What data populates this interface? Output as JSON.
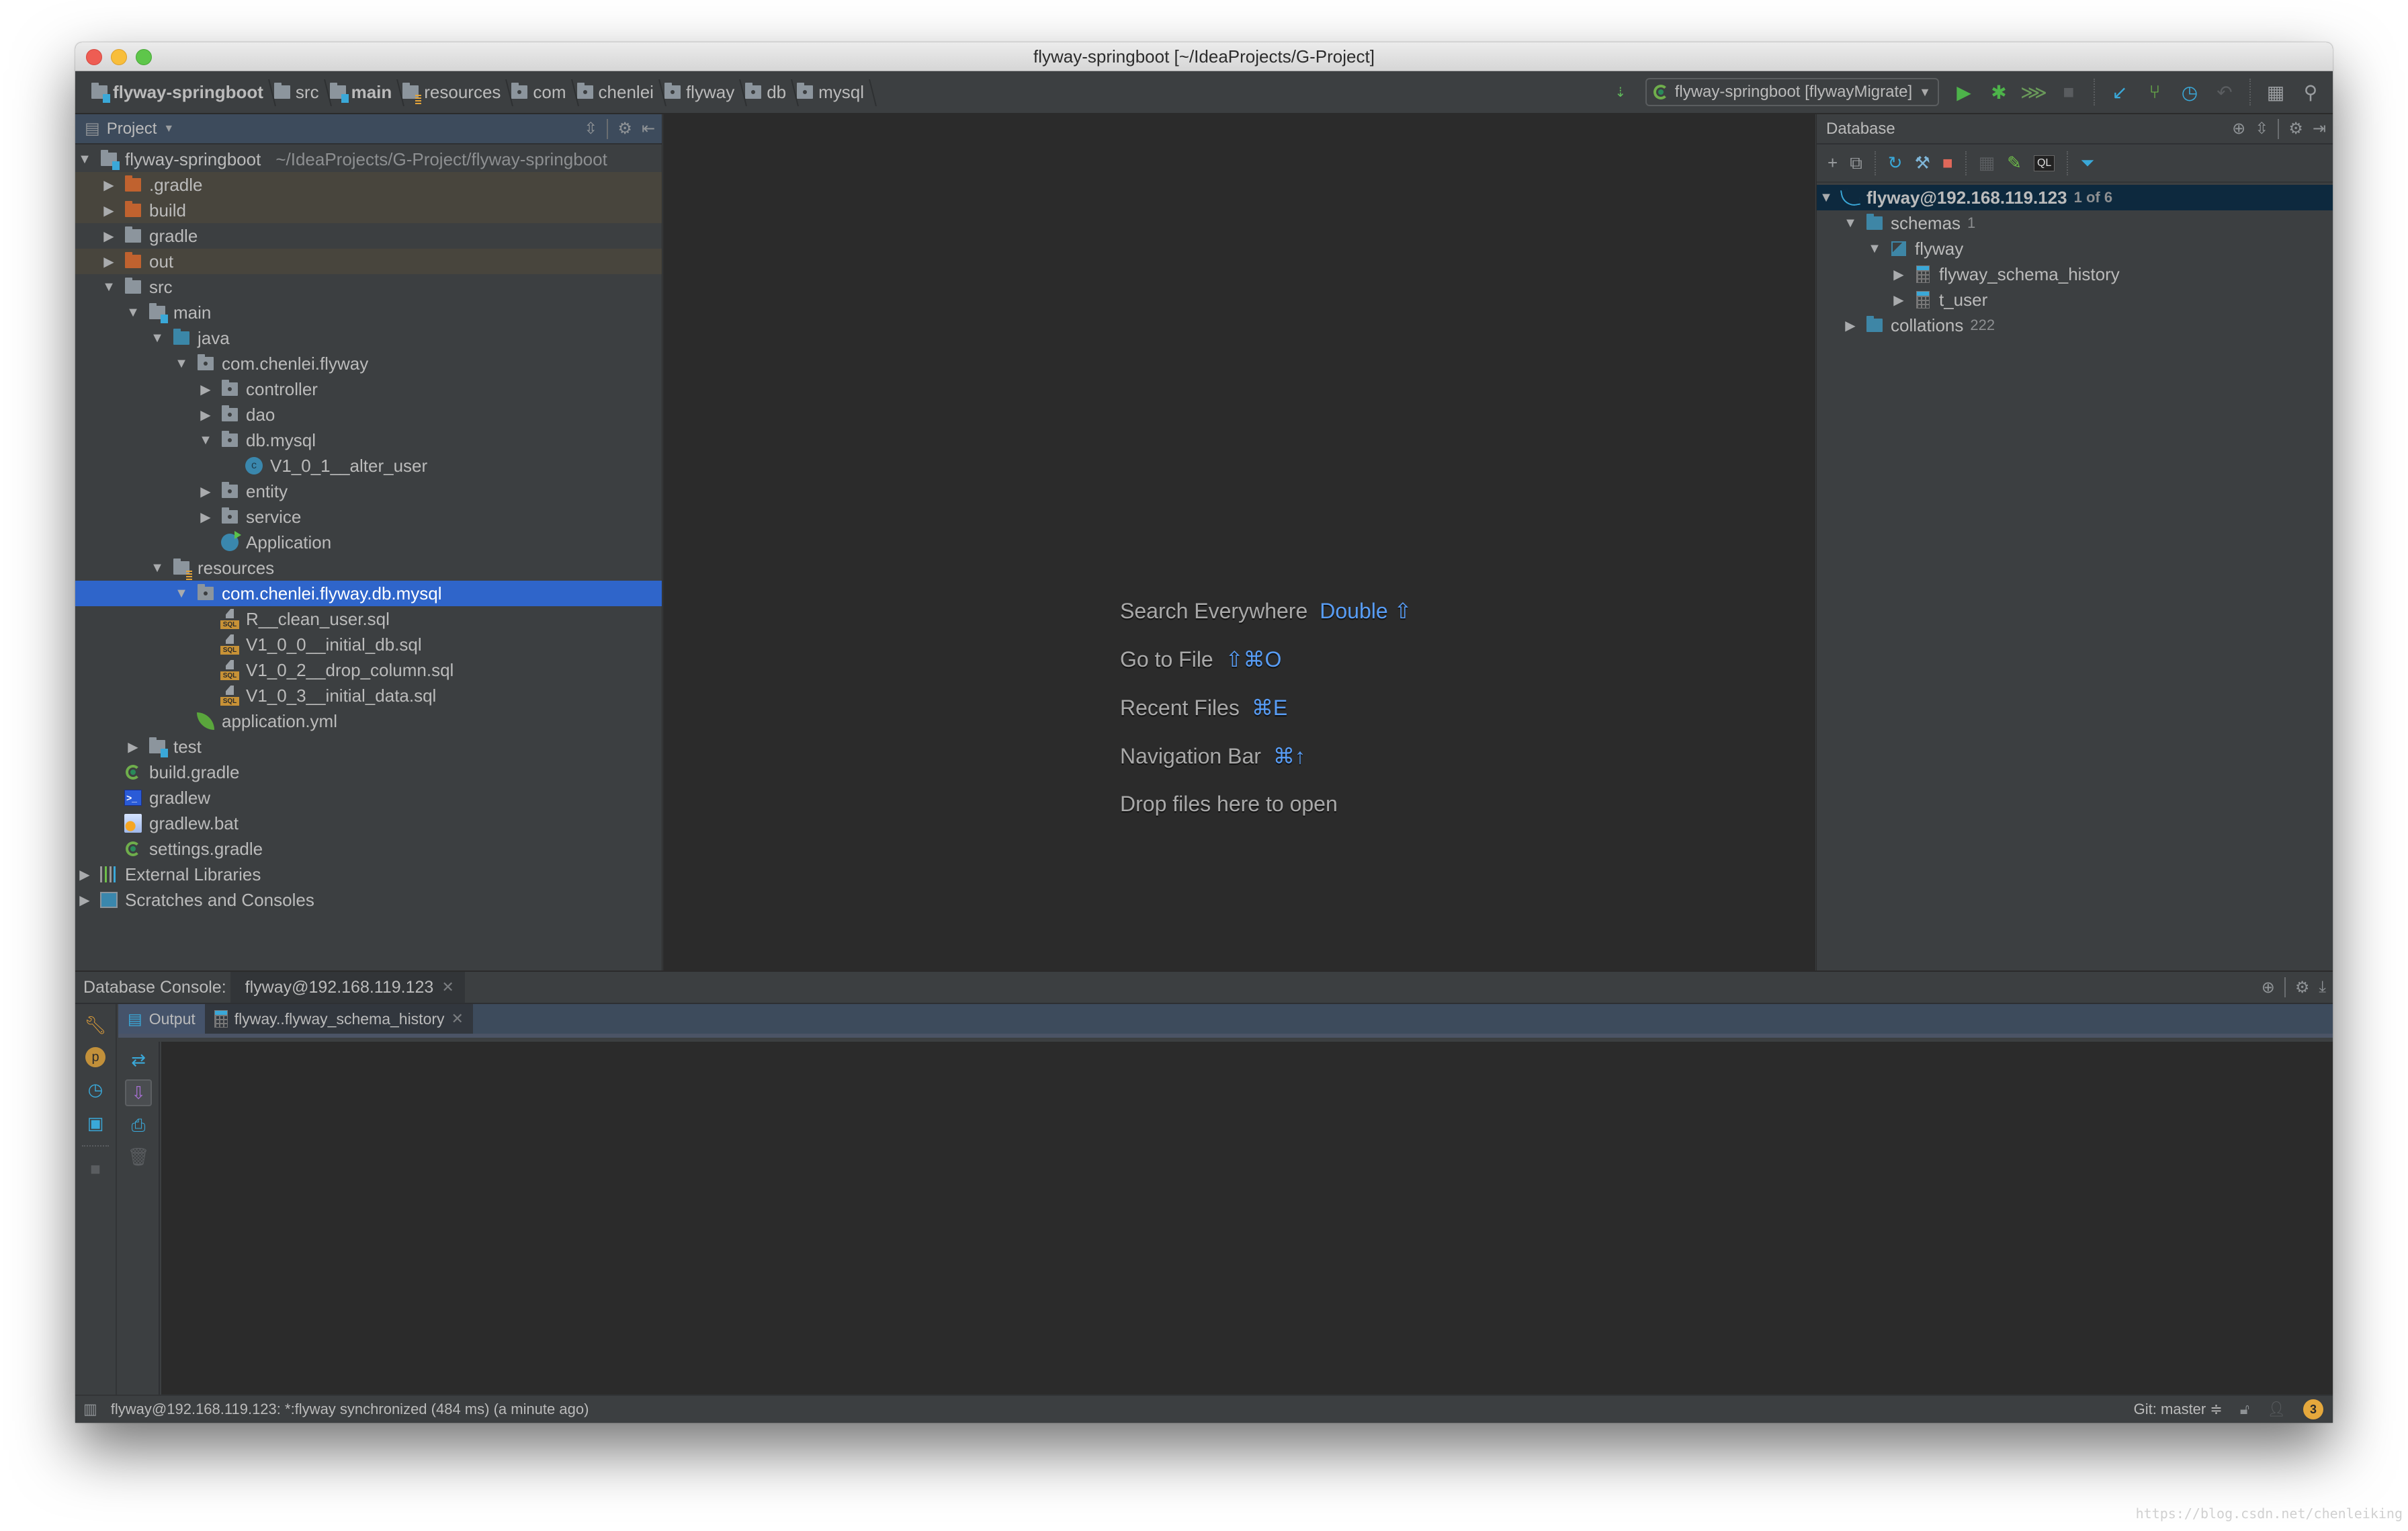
{
  "window": {
    "title": "flyway-springboot [~/IdeaProjects/G-Project]"
  },
  "navbar": {
    "breadcrumbs": [
      {
        "label": "flyway-springboot",
        "icon": "module-folder-icon"
      },
      {
        "label": "src",
        "icon": "folder-icon"
      },
      {
        "label": "main",
        "icon": "module-folder-icon"
      },
      {
        "label": "resources",
        "icon": "resources-folder-icon"
      },
      {
        "label": "com",
        "icon": "package-icon"
      },
      {
        "label": "chenlei",
        "icon": "package-icon"
      },
      {
        "label": "flyway",
        "icon": "package-icon"
      },
      {
        "label": "db",
        "icon": "package-icon"
      },
      {
        "label": "mysql",
        "icon": "package-icon"
      }
    ],
    "run_config": "flyway-springboot [flywayMigrate]"
  },
  "project_panel": {
    "title": "Project",
    "tree": [
      {
        "label": "flyway-springboot",
        "hint": "~/IdeaProjects/G-Project/flyway-springboot",
        "level": 0,
        "state": "expanded",
        "icon": "module"
      },
      {
        "label": ".gradle",
        "level": 1,
        "state": "collapsed",
        "icon": "excluded",
        "excluded": true
      },
      {
        "label": "build",
        "level": 1,
        "state": "collapsed",
        "icon": "excluded",
        "excluded": true
      },
      {
        "label": "gradle",
        "level": 1,
        "state": "collapsed",
        "icon": "folder"
      },
      {
        "label": "out",
        "level": 1,
        "state": "collapsed",
        "icon": "excluded",
        "excluded": true
      },
      {
        "label": "src",
        "level": 1,
        "state": "expanded",
        "icon": "folder"
      },
      {
        "label": "main",
        "level": 2,
        "state": "expanded",
        "icon": "module"
      },
      {
        "label": "java",
        "level": 3,
        "state": "expanded",
        "icon": "source"
      },
      {
        "label": "com.chenlei.flyway",
        "level": 4,
        "state": "expanded",
        "icon": "package"
      },
      {
        "label": "controller",
        "level": 5,
        "state": "collapsed",
        "icon": "package"
      },
      {
        "label": "dao",
        "level": 5,
        "state": "collapsed",
        "icon": "package"
      },
      {
        "label": "db.mysql",
        "level": 5,
        "state": "expanded",
        "icon": "package"
      },
      {
        "label": "V1_0_1__alter_user",
        "level": 6,
        "state": "leaf",
        "icon": "class"
      },
      {
        "label": "entity",
        "level": 5,
        "state": "collapsed",
        "icon": "package"
      },
      {
        "label": "service",
        "level": 5,
        "state": "collapsed",
        "icon": "package"
      },
      {
        "label": "Application",
        "level": 5,
        "state": "leaf",
        "icon": "spring-class"
      },
      {
        "label": "resources",
        "level": 3,
        "state": "expanded",
        "icon": "resources"
      },
      {
        "label": "com.chenlei.flyway.db.mysql",
        "level": 4,
        "state": "expanded",
        "icon": "package",
        "selected": true
      },
      {
        "label": "R__clean_user.sql",
        "level": 5,
        "state": "leaf",
        "icon": "sql"
      },
      {
        "label": "V1_0_0__initial_db.sql",
        "level": 5,
        "state": "leaf",
        "icon": "sql"
      },
      {
        "label": "V1_0_2__drop_column.sql",
        "level": 5,
        "state": "leaf",
        "icon": "sql"
      },
      {
        "label": "V1_0_3__initial_data.sql",
        "level": 5,
        "state": "leaf",
        "icon": "sql"
      },
      {
        "label": "application.yml",
        "level": 4,
        "state": "leaf",
        "icon": "yml"
      },
      {
        "label": "test",
        "level": 2,
        "state": "collapsed",
        "icon": "module"
      },
      {
        "label": "build.gradle",
        "level": 1,
        "state": "leaf",
        "icon": "gradle"
      },
      {
        "label": "gradlew",
        "level": 1,
        "state": "leaf",
        "icon": "shell"
      },
      {
        "label": "gradlew.bat",
        "level": 1,
        "state": "leaf",
        "icon": "bat"
      },
      {
        "label": "settings.gradle",
        "level": 1,
        "state": "leaf",
        "icon": "gradle"
      },
      {
        "label": "External Libraries",
        "level": 0,
        "state": "collapsed",
        "icon": "libraries"
      },
      {
        "label": "Scratches and Consoles",
        "level": 0,
        "state": "collapsed",
        "icon": "scratches"
      }
    ]
  },
  "editor": {
    "hints": [
      {
        "label": "Search Everywhere",
        "shortcut": "Double ⇧"
      },
      {
        "label": "Go to File",
        "shortcut": "⇧⌘O"
      },
      {
        "label": "Recent Files",
        "shortcut": "⌘E"
      },
      {
        "label": "Navigation Bar",
        "shortcut": "⌘↑"
      },
      {
        "label": "Drop files here to open",
        "shortcut": ""
      }
    ]
  },
  "database_panel": {
    "title": "Database",
    "tree": [
      {
        "label": "flyway@192.168.119.123",
        "count": "1 of 6",
        "level": 0,
        "state": "expanded",
        "icon": "mysql",
        "selected": true,
        "bold": true
      },
      {
        "label": "schemas",
        "count": "1",
        "level": 1,
        "state": "expanded",
        "icon": "db-folder"
      },
      {
        "label": "flyway",
        "count": "",
        "level": 2,
        "state": "expanded",
        "icon": "schema"
      },
      {
        "label": "flyway_schema_history",
        "count": "",
        "level": 3,
        "state": "collapsed",
        "icon": "table"
      },
      {
        "label": "t_user",
        "count": "",
        "level": 3,
        "state": "collapsed",
        "icon": "table"
      },
      {
        "label": "collations",
        "count": "222",
        "level": 1,
        "state": "collapsed",
        "icon": "db-folder"
      }
    ]
  },
  "console": {
    "header_label": "Database Console:",
    "tab_label": "flyway@192.168.119.123",
    "sub_tabs": [
      {
        "label": "Output",
        "active": true
      },
      {
        "label": "flyway..flyway_schema_history",
        "active": false
      }
    ]
  },
  "statusbar": {
    "message": "flyway@192.168.119.123: *:flyway synchronized (484 ms) (a minute ago)",
    "git_branch": "Git: master ≑",
    "notifications": "3"
  },
  "watermark": "https://blog.csdn.net/chenleiking",
  "colors": {
    "selection": "#2f65ca",
    "db_selection": "#0d293e",
    "excluded_row": "#48453d",
    "shortcut": "#589df6",
    "badge": "#e5a83c"
  }
}
